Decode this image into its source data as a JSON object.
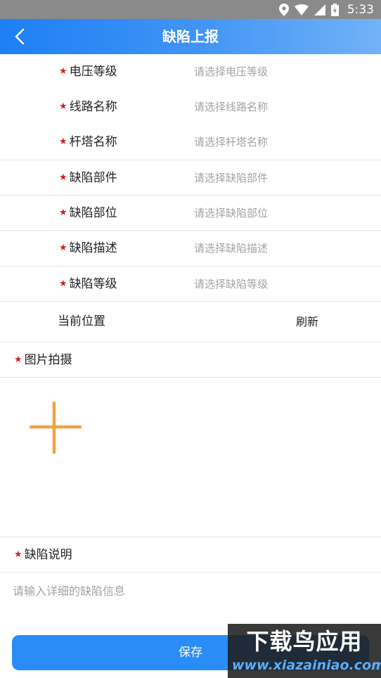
{
  "status_bar": {
    "time": "5:33",
    "icons": [
      "location-icon",
      "wifi-icon",
      "signal-icon",
      "battery-icon"
    ]
  },
  "app_bar": {
    "title": "缺陷上报",
    "back_icon": "chevron-left-icon"
  },
  "form": {
    "required_mark": "★",
    "fields": [
      {
        "label": "电压等级",
        "placeholder": "请选择电压等级"
      },
      {
        "label": "线路名称",
        "placeholder": "请选择线路名称"
      },
      {
        "label": "杆塔名称",
        "placeholder": "请选择杆塔名称"
      },
      {
        "label": "缺陷部件",
        "placeholder": "请选择缺陷部件"
      },
      {
        "label": "缺陷部位",
        "placeholder": "请选择缺陷部位"
      },
      {
        "label": "缺陷描述",
        "placeholder": "请选择缺陷描述"
      },
      {
        "label": "缺陷等级",
        "placeholder": "请选择缺陷等级"
      }
    ],
    "location": {
      "label": "当前位置",
      "refresh_label": "刷新"
    },
    "photo": {
      "label": "图片拍摄",
      "add_icon": "plus-icon"
    },
    "description": {
      "label": "缺陷说明",
      "placeholder": "请输入详细的缺陷信息"
    },
    "save_label": "保存"
  },
  "watermark": {
    "title": "下载鸟应用",
    "url": "www.xiazainiao.com"
  },
  "colors": {
    "primary": "#2a8cf6",
    "required": "#d02020",
    "placeholder": "#a3a3a3",
    "add_icon": "#e9a545"
  }
}
